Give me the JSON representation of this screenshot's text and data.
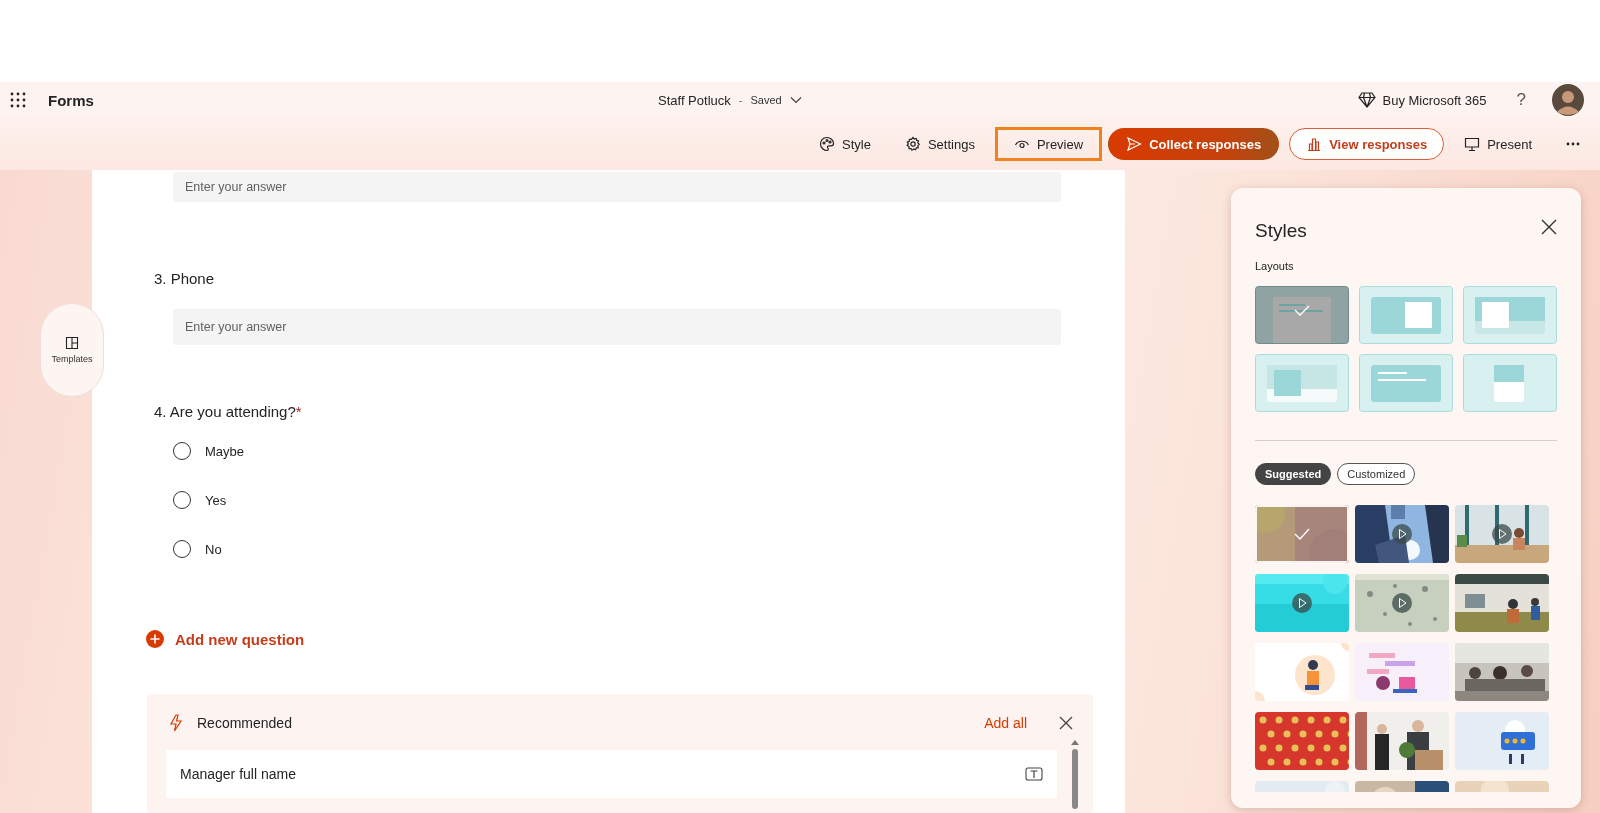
{
  "app_bar": {
    "app_name": "Forms",
    "form_title": "Staff Potluck",
    "separator": "-",
    "save_status": "Saved",
    "buy_label": "Buy Microsoft 365",
    "help": "?"
  },
  "commands": [
    {
      "kind": "plain",
      "label": "Style",
      "highlighted": false
    },
    {
      "kind": "plain",
      "label": "Settings",
      "highlighted": false
    },
    {
      "kind": "plain",
      "label": "Preview",
      "highlighted": true
    },
    {
      "kind": "primary",
      "label": "Collect responses",
      "highlighted": false
    },
    {
      "kind": "outline",
      "label": "View responses",
      "highlighted": false
    },
    {
      "kind": "plain",
      "label": "Present",
      "highlighted": false
    }
  ],
  "rail": {
    "label": "Templates"
  },
  "form": {
    "top_field": {
      "placeholder": "Enter your answer"
    },
    "questions": [
      {
        "kind": "text",
        "number": "3.",
        "title": "Phone",
        "placeholder": "Enter your answer"
      },
      {
        "kind": "choice",
        "number": "4.",
        "title": "Are you attending?",
        "required_mark": "*",
        "options": [
          {
            "label": "Maybe",
            "selected": false
          },
          {
            "label": "Yes",
            "selected": false
          },
          {
            "label": "No",
            "selected": false
          }
        ]
      }
    ],
    "add_question": "Add new question",
    "recommended": {
      "title": "Recommended",
      "add_all": "Add all",
      "items": [
        {
          "label": "Manager full name"
        }
      ]
    }
  },
  "styles_panel": {
    "title": "Styles",
    "layouts_label": "Layouts",
    "layouts": [
      {
        "kind": "plain",
        "selected": true
      },
      {
        "kind": "right-image",
        "selected": false
      },
      {
        "kind": "left-image-banner",
        "selected": false
      },
      {
        "kind": "low-image",
        "selected": false
      },
      {
        "kind": "text-card",
        "selected": false
      },
      {
        "kind": "top-image",
        "selected": false
      }
    ],
    "filters": [
      {
        "label": "Suggested",
        "selected": true
      },
      {
        "label": "Customized",
        "selected": false
      }
    ],
    "themes": [
      {
        "kind": "picture",
        "video": false,
        "selected": true
      },
      {
        "kind": "picture",
        "video": true,
        "selected": false
      },
      {
        "kind": "picture",
        "video": true,
        "selected": false
      },
      {
        "kind": "picture",
        "video": true,
        "selected": false
      },
      {
        "kind": "picture",
        "video": true,
        "selected": false
      },
      {
        "kind": "picture",
        "video": false,
        "selected": false
      },
      {
        "kind": "picture",
        "video": false,
        "selected": false
      },
      {
        "kind": "picture",
        "video": false,
        "selected": false
      },
      {
        "kind": "picture",
        "video": false,
        "selected": false
      },
      {
        "kind": "picture",
        "video": false,
        "selected": false
      },
      {
        "kind": "picture",
        "video": false,
        "selected": false
      },
      {
        "kind": "picture",
        "video": false,
        "selected": false
      },
      {
        "kind": "picture",
        "selected": false
      },
      {
        "kind": "picture",
        "selected": false
      },
      {
        "kind": "picture",
        "selected": false
      }
    ]
  }
}
